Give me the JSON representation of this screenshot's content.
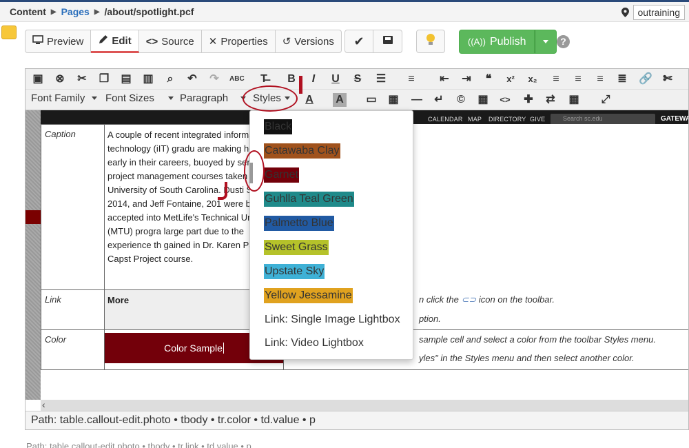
{
  "breadcrumb": {
    "root": "Content",
    "section": "Pages",
    "file": "/about/spotlight.pcf"
  },
  "site_selector": "outraining",
  "toolbar": {
    "preview": "Preview",
    "edit": "Edit",
    "source": "Source",
    "properties": "Properties",
    "versions": "Versions",
    "publish": "Publish",
    "help": "?"
  },
  "editor_toolbar": {
    "font_family": "Font Family",
    "font_sizes": "Font Sizes",
    "paragraph": "Paragraph",
    "styles": "Styles"
  },
  "site_header": {
    "nav": [
      "CALENDAR",
      "MAP",
      "DIRECTORY",
      "GIVE"
    ],
    "search_placeholder": "Search sc.edu",
    "gateway": "GATEWA"
  },
  "callout_table": {
    "caption_label": "Caption",
    "caption_text": "A couple of recent integrated information technology (iIT) gradu are making headway early in their careers, buoyed by senior project management courses taken at the University of South Carolina. Dusti Smith, 2014, and Jeff Fontaine, 201 were both accepted into MetLife's Technical University (MTU) progra large part due to the experience th gained in Dr. Karen Patten's Capst Project course.",
    "link_label": "Link",
    "link_text": "More",
    "link_desc_1": "n click the",
    "link_desc_1b": "icon on the toolbar.",
    "link_desc_2": "ption.",
    "color_label": "Color",
    "color_sample": "Color Sample",
    "color_desc_1": "sample cell and select a color from the toolbar Styles menu.",
    "color_desc_2": "yles\" in the Styles menu and then select another color."
  },
  "styles_menu": [
    {
      "label": "Black",
      "bg": "#111111",
      "fg": "#333333"
    },
    {
      "label": "Catawaba Clay",
      "bg": "#a0521c",
      "fg": "#333333"
    },
    {
      "label": "Garnet",
      "bg": "#73000a",
      "fg": "#333333"
    },
    {
      "label": "Guhlla Teal Green",
      "bg": "#1f8a8a",
      "fg": "#333333"
    },
    {
      "label": "Palmetto Blue",
      "bg": "#215aa3",
      "fg": "#333333"
    },
    {
      "label": "Sweet Grass",
      "bg": "#b5c22a",
      "fg": "#333333"
    },
    {
      "label": "Upstate Sky",
      "bg": "#3fb1d6",
      "fg": "#333333"
    },
    {
      "label": "Yellow Jessamine",
      "bg": "#e0a21f",
      "fg": "#333333"
    },
    {
      "label": "Link: Single Image Lightbox",
      "bg": "",
      "fg": "#333333"
    },
    {
      "label": "Link: Video Lightbox",
      "bg": "",
      "fg": "#333333"
    }
  ],
  "path_bar": "Path:  table.callout-edit.photo • tbody • tr.color • td.value • p",
  "ghost_path": "Path:  table.callout-edit.photo • tbody • tr.link • td.value • p",
  "colors": {
    "accent_green": "#5cb85c",
    "brand_blue": "#2a6ebb",
    "annotation_red": "#b01020",
    "garnet": "#73000a"
  }
}
